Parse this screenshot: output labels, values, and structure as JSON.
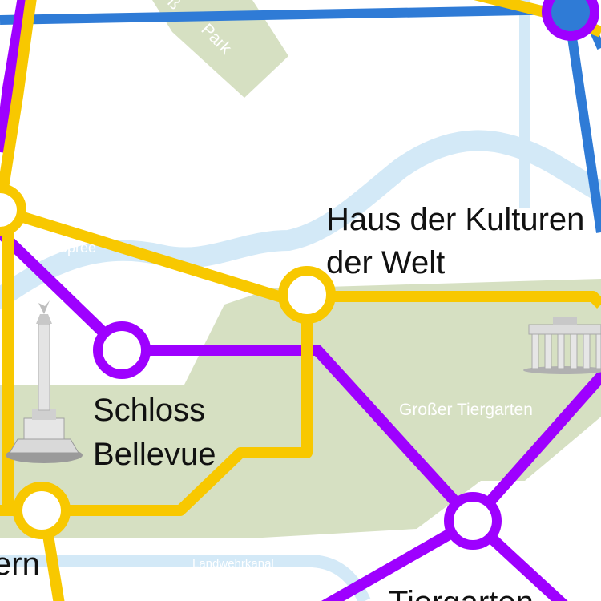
{
  "colors": {
    "background": "#ffffff",
    "park": "#d6e0c2",
    "water": "#d3e9f7",
    "line_yellow": "#f8c800",
    "line_purple": "#9e00ff",
    "line_blue": "#2f7bd6",
    "station_fill": "#ffffff",
    "label_text": "#111111"
  },
  "stations": {
    "haus_der_kulturen": {
      "line1": "Haus der Kulturen",
      "line2": "der Welt"
    },
    "schloss_bellevue": {
      "line1": "Schloss",
      "line2": "Bellevue"
    },
    "tiergarten": {
      "label": "Tiergarten"
    },
    "left_edge": {
      "label": "ern"
    }
  },
  "areas": {
    "grosser_tiergarten": "Großer Tiergarten",
    "park_top": "Park",
    "park_top_cut": "ß"
  },
  "water": {
    "spree": "Spree",
    "landwehrkanal": "Landwehrkanal"
  },
  "landmarks": {
    "victory_column": "siegessaeule-icon",
    "brandenburg_gate": "brandenburg-gate-icon"
  }
}
